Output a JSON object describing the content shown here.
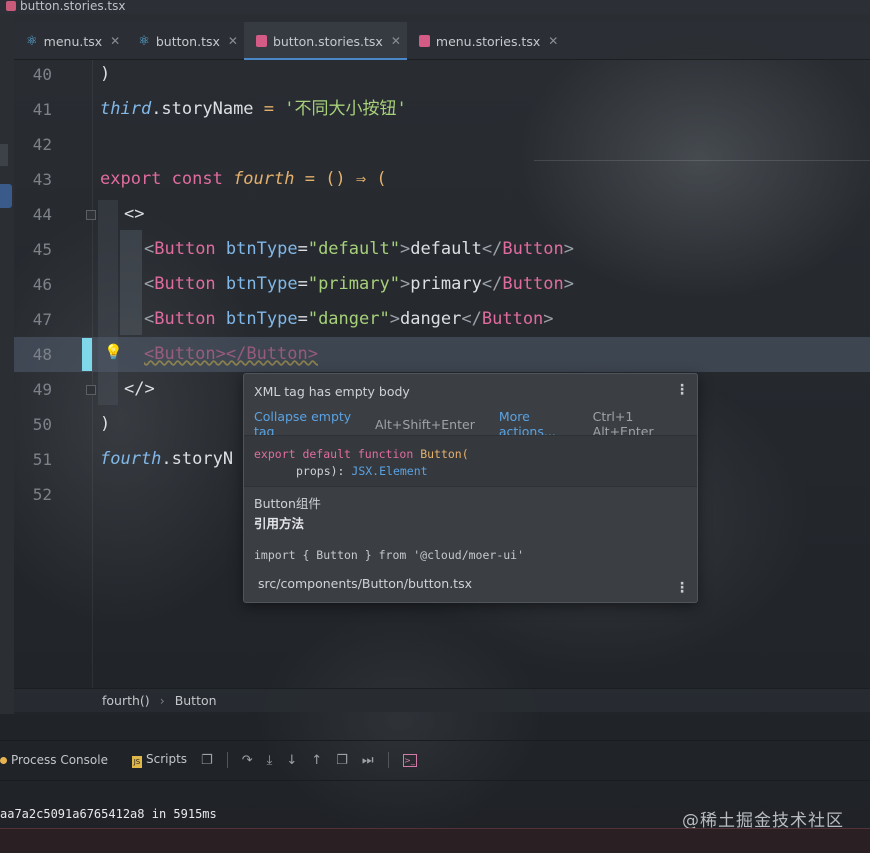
{
  "top_path": {
    "file": "button.stories.tsx"
  },
  "tabs": [
    {
      "label": "menu.tsx",
      "icon": "react-icon"
    },
    {
      "label": "button.tsx",
      "icon": "react-icon"
    },
    {
      "label": "button.stories.tsx",
      "icon": "storybook-icon",
      "active": true
    },
    {
      "label": "menu.stories.tsx",
      "icon": "storybook-icon"
    }
  ],
  "lines": {
    "n40": "40",
    "n41": "41",
    "n42": "42",
    "n43": "43",
    "n44": "44",
    "n45": "45",
    "n46": "46",
    "n47": "47",
    "n48": "48",
    "n49": "49",
    "n50": "50",
    "n51": "51",
    "n52": "52"
  },
  "code": {
    "l40": ")",
    "l41_id": "third",
    "l41_prop": ".storyName",
    "l41_eq": " = ",
    "l41_str": "'不同大小按钮'",
    "l43_kw": "export const ",
    "l43_fn": "fourth",
    "l43_rest": " = () ⇒ (",
    "l44": "<>",
    "tag_open": "<",
    "tag_name": "Button",
    "attr": "btnType",
    "eq": "=",
    "v45": "\"default\"",
    "t45": "default",
    "v46": "\"primary\"",
    "t46": "primary",
    "v47": "\"danger\"",
    "t47": "danger",
    "close_open": "</",
    "close": ">",
    "l48": "<Button></Button>",
    "l49": "</>",
    "l50": ")",
    "l51_id": "fourth",
    "l51_prop": ".storyN"
  },
  "popup": {
    "title": "XML tag has empty body",
    "action1": "Collapse empty tag",
    "shortcut1": "Alt+Shift+Enter",
    "action2": "More actions...",
    "shortcut2": "Ctrl+1 Alt+Enter",
    "sig_kw": "export default function",
    "sig_fn": "Button(",
    "sig_param": "props): ",
    "sig_type": "JSX",
    "sig_type2": ".Element",
    "desc1": "Button组件",
    "desc2": "引用方法",
    "import_line": "import { Button } from '@cloud/moer-ui'",
    "path": "src/components/Button/button.tsx"
  },
  "breadcrumb": {
    "item1": "fourth()",
    "item2": "Button"
  },
  "toolbar": {
    "process_console": "Process Console",
    "scripts": "Scripts"
  },
  "terminal": {
    "line": "aa7a2c5091a6765412a8 in 5915ms"
  },
  "watermark": "@稀土掘金技术社区"
}
